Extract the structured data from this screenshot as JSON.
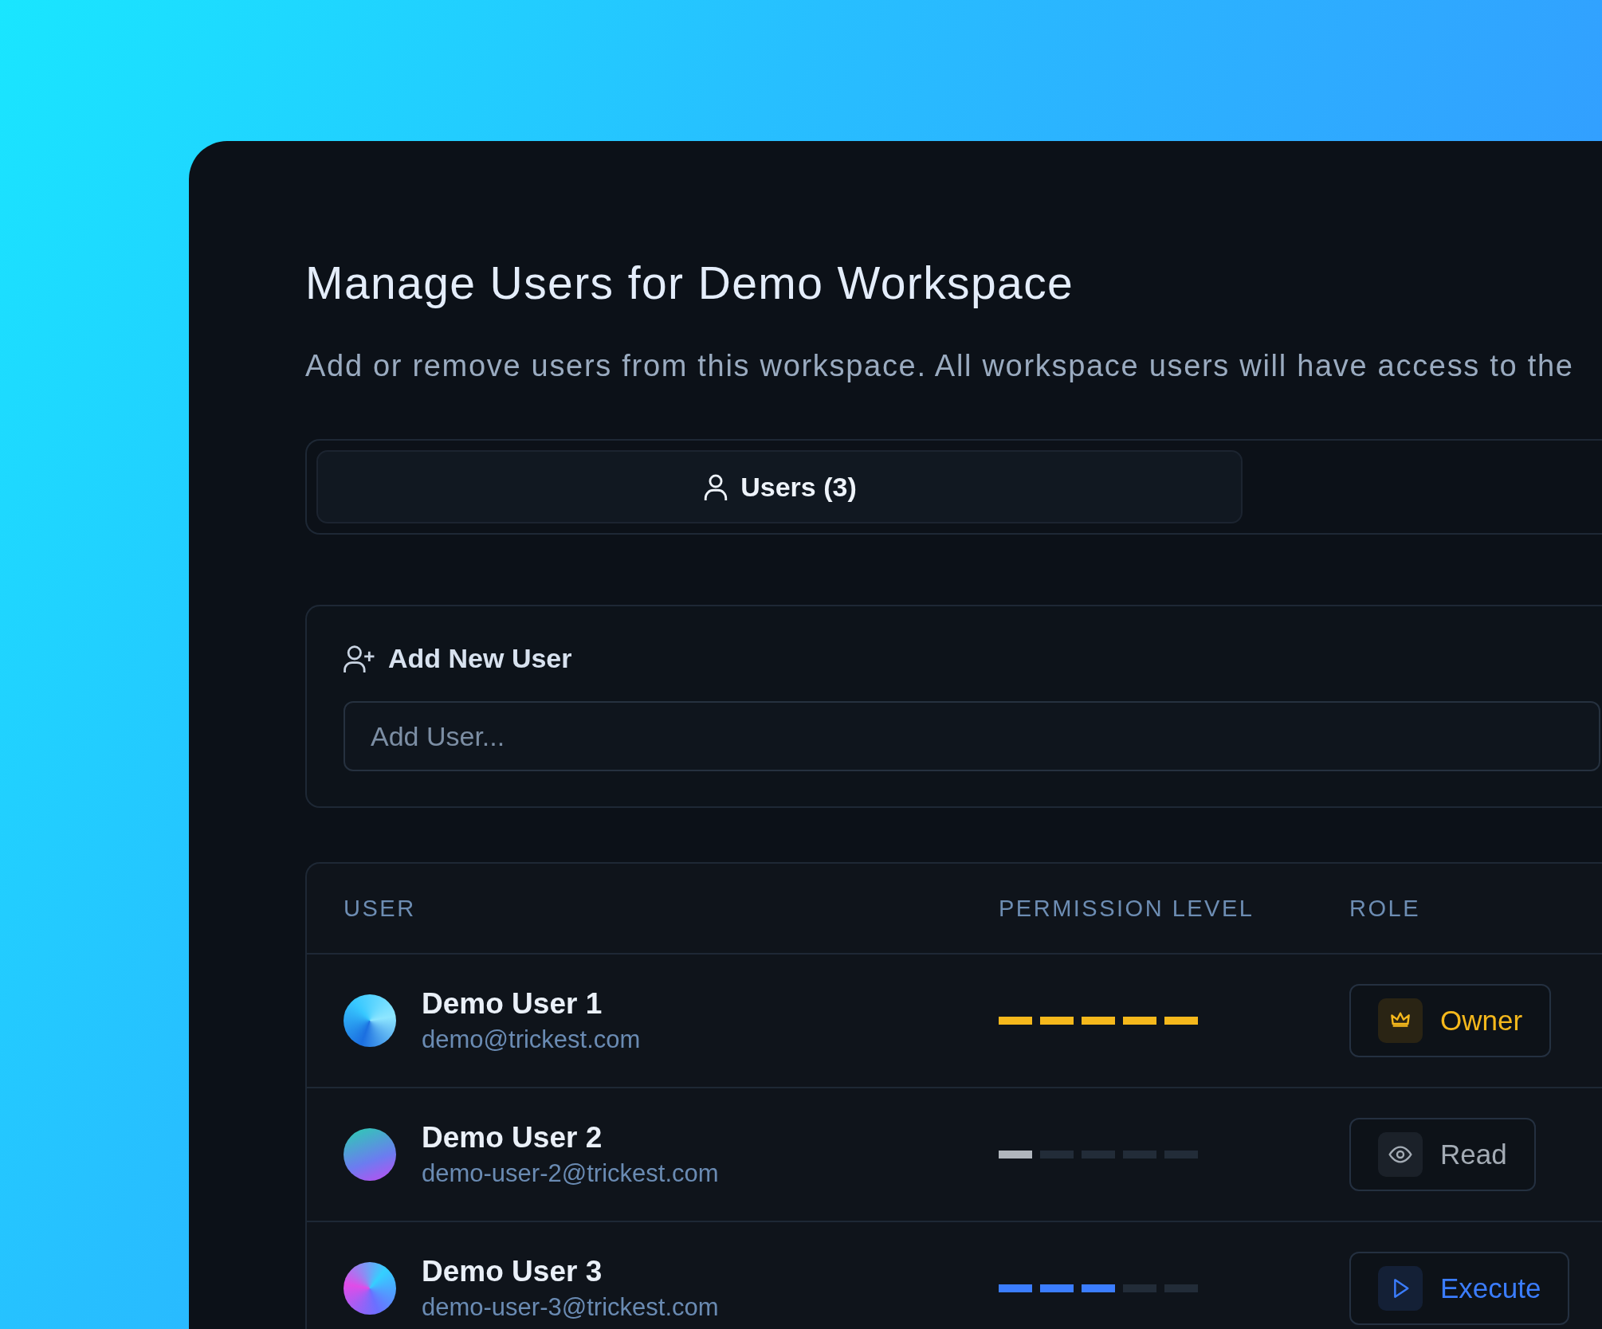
{
  "dialog": {
    "title": "Manage Users for Demo Workspace",
    "description": "Add or remove users from this workspace. All workspace users will have access to the"
  },
  "tabs": [
    {
      "label": "Users (3)",
      "selected": true
    }
  ],
  "add_user": {
    "heading": "Add New User",
    "placeholder": "Add User..."
  },
  "table": {
    "columns": [
      "USER",
      "PERMISSION LEVEL",
      "ROLE"
    ],
    "rows": [
      {
        "name": "Demo User 1",
        "email": "demo@trickest.com",
        "level": 1,
        "role": {
          "kind": "owner",
          "label": "Owner"
        }
      },
      {
        "name": "Demo User 2",
        "email": "demo-user-2@trickest.com",
        "level": 0.2,
        "role": {
          "kind": "read",
          "label": "Read"
        }
      },
      {
        "name": "Demo User 3",
        "email": "demo-user-3@trickest.com",
        "level": 0.6,
        "role": {
          "kind": "execute",
          "label": "Execute"
        }
      }
    ]
  }
}
